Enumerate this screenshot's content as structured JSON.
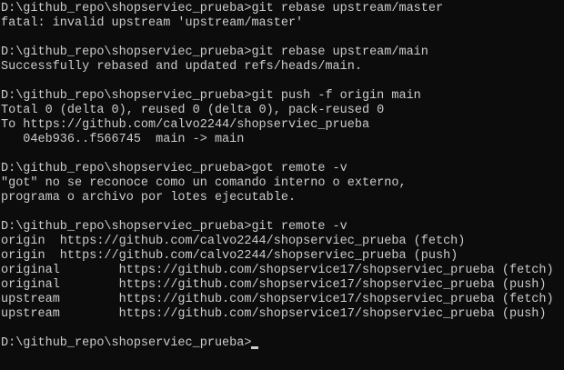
{
  "terminal": {
    "lines": [
      "D:\\github_repo\\shopserviec_prueba>git rebase upstream/master",
      "fatal: invalid upstream 'upstream/master'",
      "",
      "D:\\github_repo\\shopserviec_prueba>git rebase upstream/main",
      "Successfully rebased and updated refs/heads/main.",
      "",
      "D:\\github_repo\\shopserviec_prueba>git push -f origin main",
      "Total 0 (delta 0), reused 0 (delta 0), pack-reused 0",
      "To https://github.com/calvo2244/shopserviec_prueba",
      "   04eb936..f566745  main -> main",
      "",
      "D:\\github_repo\\shopserviec_prueba>got remote -v",
      "\"got\" no se reconoce como un comando interno o externo,",
      "programa o archivo por lotes ejecutable.",
      "",
      "D:\\github_repo\\shopserviec_prueba>git remote -v",
      "origin  https://github.com/calvo2244/shopserviec_prueba (fetch)",
      "origin  https://github.com/calvo2244/shopserviec_prueba (push)",
      "original        https://github.com/shopservice17/shopserviec_prueba (fetch)",
      "original        https://github.com/shopservice17/shopserviec_prueba (push)",
      "upstream        https://github.com/shopservice17/shopserviec_prueba (fetch)",
      "upstream        https://github.com/shopservice17/shopserviec_prueba (push)",
      ""
    ],
    "prompt": "D:\\github_repo\\shopserviec_prueba>",
    "colors": {
      "background": "#0c0c0c",
      "foreground": "#cccccc"
    }
  }
}
